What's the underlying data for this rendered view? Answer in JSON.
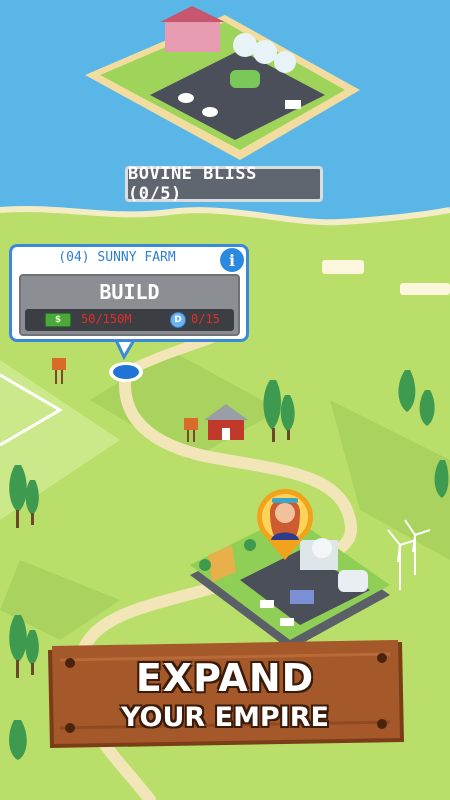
{
  "map": {
    "locked_island_label": "BOVINE BLISS (0/5)"
  },
  "build_popup": {
    "title": "(04) SUNNY FARM",
    "info_icon": "i",
    "build_label": "BUILD",
    "cash_icon_glyph": "$",
    "cash_cost": "50/150M",
    "coin_icon_glyph": "D",
    "coin_cost": "0/15"
  },
  "banner": {
    "line1": "EXPAND",
    "line2": "YOUR EMPIRE"
  },
  "colors": {
    "sea": "#5ab6e6",
    "land": "#b9df6a",
    "road": "#f2e6b8",
    "popup_border": "#3b8ad9",
    "cost_red": "#e0302a",
    "banner_wood": "#a5582a"
  }
}
